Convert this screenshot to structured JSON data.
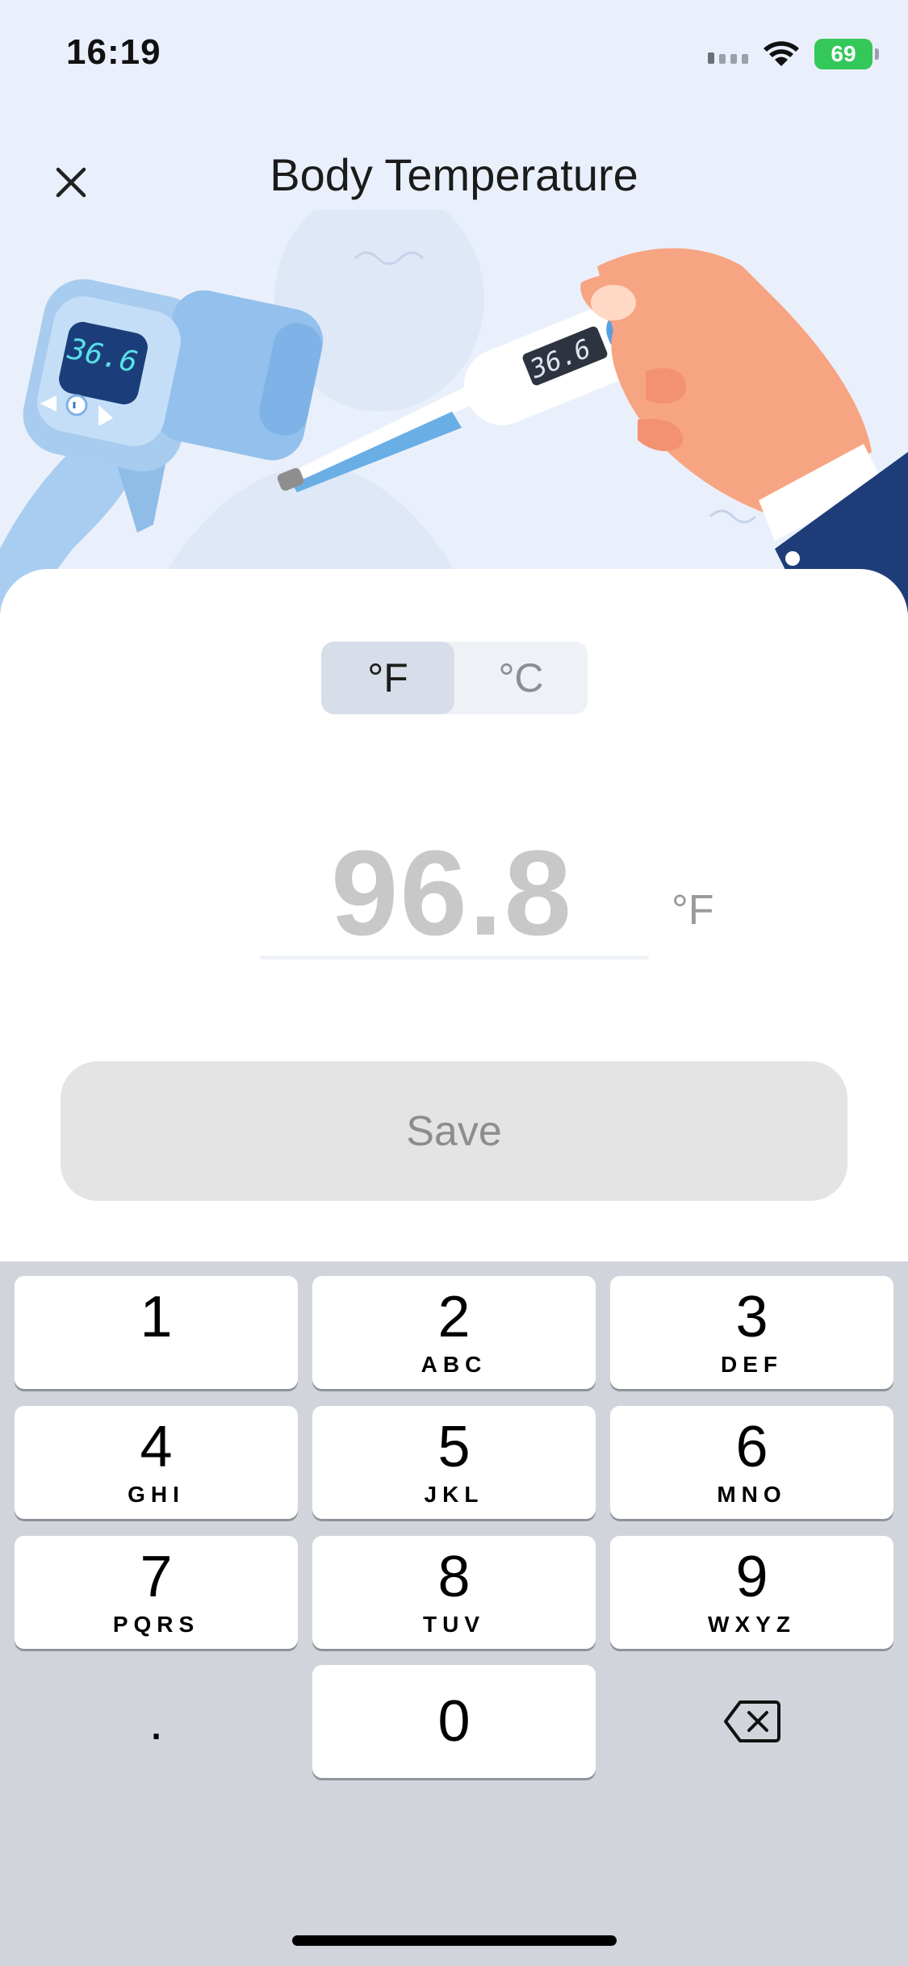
{
  "status_bar": {
    "time": "16:19",
    "battery": "69"
  },
  "header": {
    "title": "Body Temperature"
  },
  "illustration": {
    "gun_display": "36.6",
    "thermometer_display": "36.6"
  },
  "unit_toggle": {
    "options": [
      {
        "label": "°F",
        "selected": true
      },
      {
        "label": "°C",
        "selected": false
      }
    ]
  },
  "reading": {
    "value": "96.8",
    "unit": "°F"
  },
  "save_label": "Save",
  "keypad": {
    "keys": [
      {
        "num": "1",
        "letters": ""
      },
      {
        "num": "2",
        "letters": "ABC"
      },
      {
        "num": "3",
        "letters": "DEF"
      },
      {
        "num": "4",
        "letters": "GHI"
      },
      {
        "num": "5",
        "letters": "JKL"
      },
      {
        "num": "6",
        "letters": "MNO"
      },
      {
        "num": "7",
        "letters": "PQRS"
      },
      {
        "num": "8",
        "letters": "TUV"
      },
      {
        "num": "9",
        "letters": "WXYZ"
      },
      {
        "num": "0",
        "letters": ""
      }
    ],
    "decimal": ".",
    "delete_icon": "backspace-icon"
  },
  "colors": {
    "hero_bg": "#eaf0fb",
    "battery_green": "#34c759",
    "save_bg": "#e4e4e4",
    "keyboard_bg": "#d1d4db"
  }
}
